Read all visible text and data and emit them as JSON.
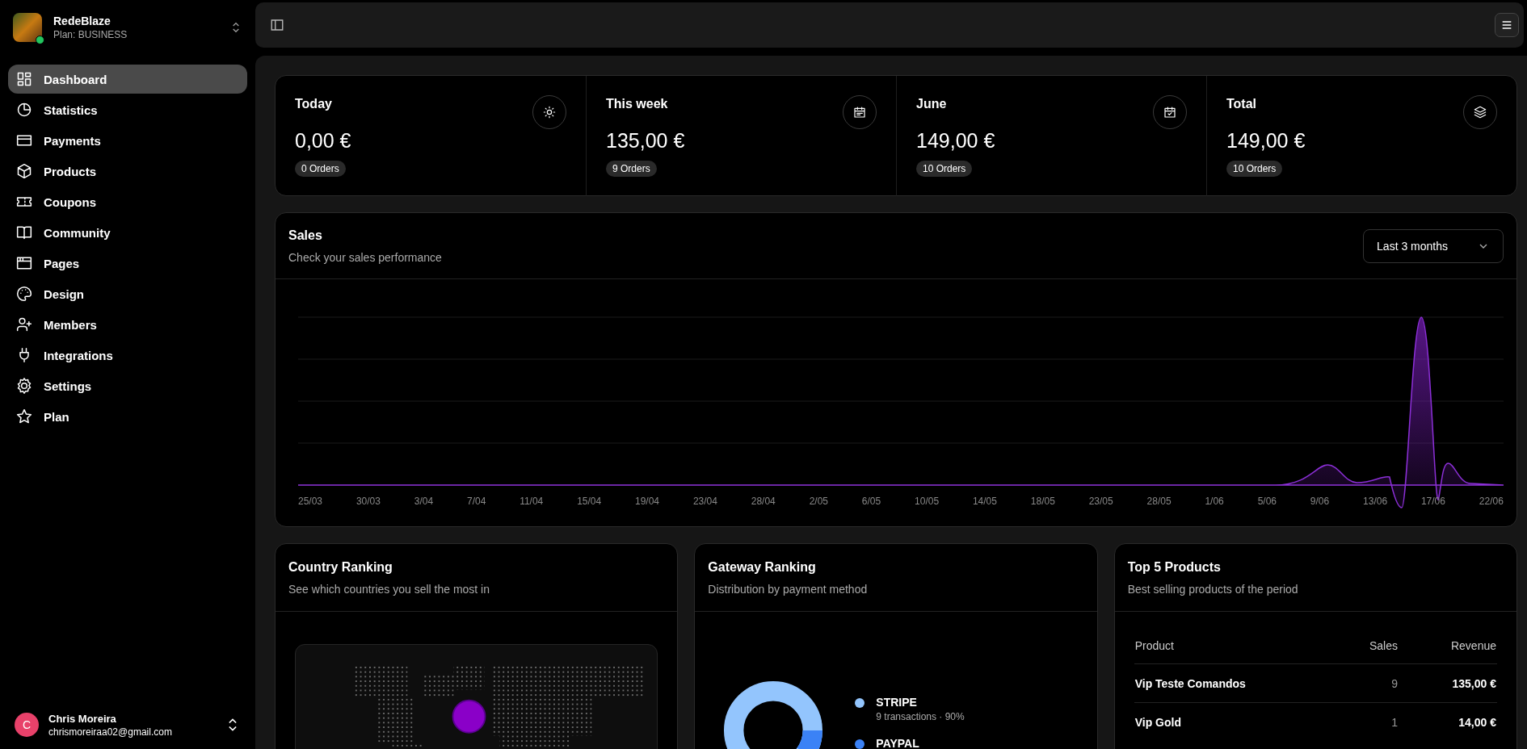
{
  "workspace": {
    "name": "RedeBlaze",
    "plan": "Plan: BUSINESS",
    "online": true
  },
  "nav": [
    {
      "label": "Dashboard",
      "selected": true
    },
    {
      "label": "Statistics",
      "selected": false
    },
    {
      "label": "Payments",
      "selected": false
    },
    {
      "label": "Products",
      "selected": false
    },
    {
      "label": "Coupons",
      "selected": false
    },
    {
      "label": "Community",
      "selected": false
    },
    {
      "label": "Pages",
      "selected": false
    },
    {
      "label": "Design",
      "selected": false
    },
    {
      "label": "Members",
      "selected": false
    },
    {
      "label": "Integrations",
      "selected": false
    },
    {
      "label": "Settings",
      "selected": false
    },
    {
      "label": "Plan",
      "selected": false
    }
  ],
  "user": {
    "initial": "C",
    "name": "Chris Moreira",
    "email": "chrismoreiraa02@gmail.com"
  },
  "stats": [
    {
      "title": "Today",
      "value": "0,00 €",
      "orders": "0 Orders"
    },
    {
      "title": "This week",
      "value": "135,00 €",
      "orders": "9 Orders"
    },
    {
      "title": "June",
      "value": "149,00 €",
      "orders": "10 Orders"
    },
    {
      "title": "Total",
      "value": "149,00 €",
      "orders": "10 Orders"
    }
  ],
  "sales": {
    "title": "Sales",
    "subtitle": "Check your sales performance",
    "range": "Last 3 months",
    "x_labels": [
      "25/03",
      "30/03",
      "3/04",
      "7/04",
      "11/04",
      "15/04",
      "19/04",
      "23/04",
      "28/04",
      "2/05",
      "6/05",
      "10/05",
      "14/05",
      "18/05",
      "23/05",
      "28/05",
      "1/06",
      "5/06",
      "9/06",
      "13/06",
      "17/06",
      "22/06"
    ]
  },
  "country_ranking": {
    "title": "Country Ranking",
    "subtitle": "See which countries you sell the most in"
  },
  "gateway_ranking": {
    "title": "Gateway Ranking",
    "subtitle": "Distribution by payment method",
    "gateways": [
      {
        "name": "STRIPE",
        "detail": "9 transactions · 90%",
        "color": "#93c5fd"
      },
      {
        "name": "PAYPAL",
        "color": "#3b82f6"
      }
    ]
  },
  "top_products": {
    "title": "Top 5 Products",
    "subtitle": "Best selling products of the period",
    "columns": [
      "Product",
      "Sales",
      "Revenue"
    ],
    "rows": [
      [
        "Vip Teste Comandos",
        "9",
        "135,00 €"
      ],
      [
        "Vip Gold",
        "1",
        "14,00 €"
      ]
    ]
  }
}
